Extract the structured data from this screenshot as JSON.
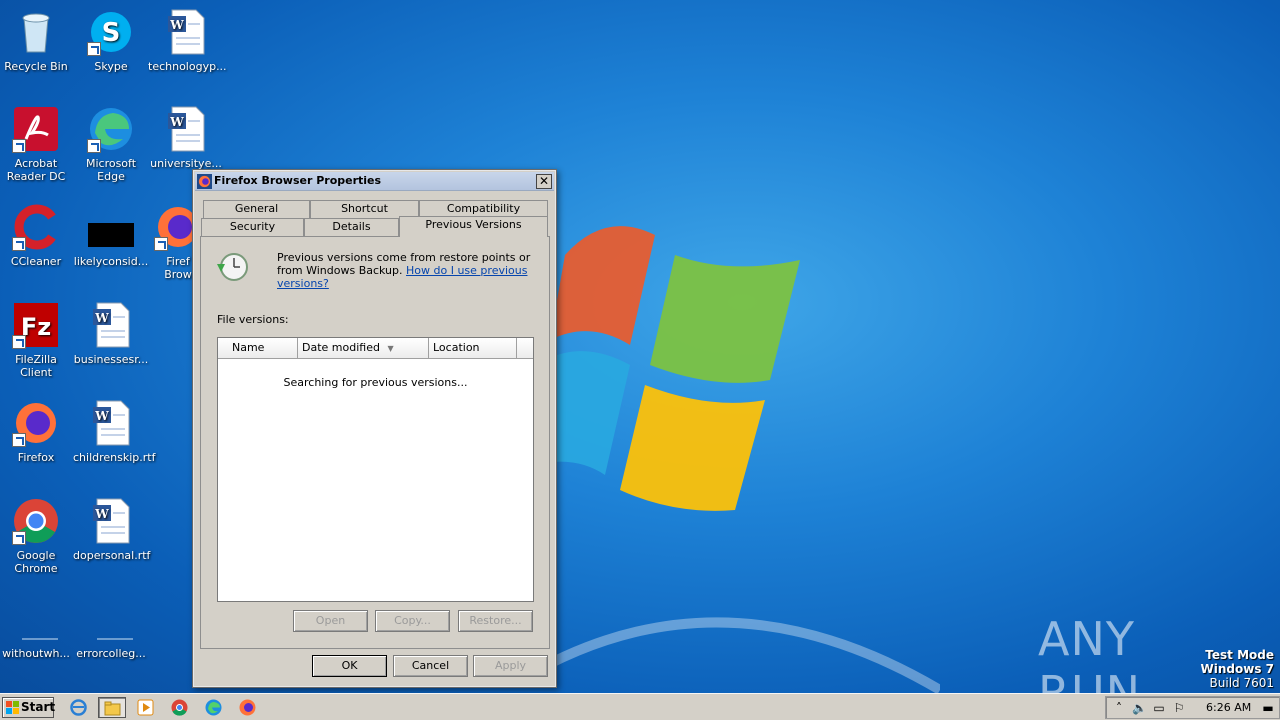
{
  "desktop": {
    "icons": [
      {
        "label": "Recycle Bin"
      },
      {
        "label": "Skype"
      },
      {
        "label": "technologyp..."
      },
      {
        "label": "Acrobat Reader DC"
      },
      {
        "label": "Microsoft Edge"
      },
      {
        "label": "universitye..."
      },
      {
        "label": "CCleaner"
      },
      {
        "label": "likelyconsid..."
      },
      {
        "label": "Firef Brow"
      },
      {
        "label": "FileZilla Client"
      },
      {
        "label": "businessesr..."
      },
      {
        "label": "Firefox"
      },
      {
        "label": "childrenskip.rtf"
      },
      {
        "label": "Google Chrome"
      },
      {
        "label": "dopersonal.rtf"
      },
      {
        "label": "withoutwh..."
      },
      {
        "label": "errorcolleg..."
      }
    ]
  },
  "dialog": {
    "title": "Firefox Browser Properties",
    "close_label": "✕",
    "tabs": [
      {
        "label": "General"
      },
      {
        "label": "Shortcut"
      },
      {
        "label": "Compatibility"
      },
      {
        "label": "Security"
      },
      {
        "label": "Details"
      },
      {
        "label": "Previous Versions"
      }
    ],
    "active_tab": "Previous Versions",
    "info_text": "Previous versions come from restore points or from Windows Backup.",
    "info_link": "How do I use previous versions?",
    "file_versions_label": "File versions:",
    "columns": [
      {
        "label": "Name"
      },
      {
        "label": "Date modified"
      },
      {
        "label": "Location"
      }
    ],
    "status_text": "Searching for previous versions...",
    "action_buttons": {
      "open": "Open",
      "copy": "Copy...",
      "restore": "Restore..."
    },
    "footer_buttons": {
      "ok": "OK",
      "cancel": "Cancel",
      "apply": "Apply"
    }
  },
  "watermark": {
    "line1": "Test Mode",
    "line2": "Windows 7",
    "line3": "Build 7601",
    "brand": "ANY RUN"
  },
  "taskbar": {
    "start_label": "Start",
    "clock": "6:26 AM"
  }
}
